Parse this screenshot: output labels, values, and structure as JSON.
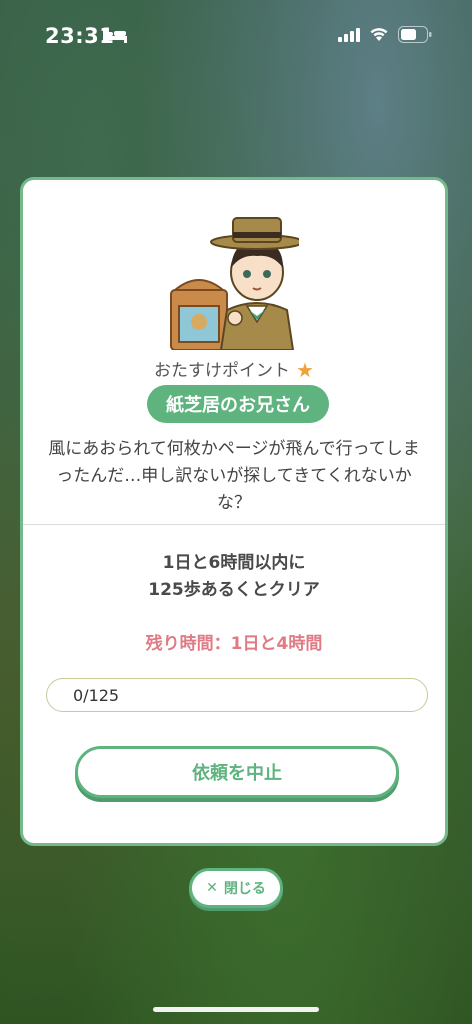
{
  "status_bar": {
    "time": "23:31",
    "sleep_icon": "bed-icon",
    "signal_icon": "cellular-signal-icon",
    "wifi_icon": "wifi-icon",
    "battery_icon": "battery-icon"
  },
  "card": {
    "illustration": "kamishibai-man-illustration",
    "points_label": "おたすけポイント",
    "points_icon": "star-icon",
    "name": "紙芝居のお兄さん",
    "message": "風にあおられて何枚かページが飛んで行ってしまったんだ…申し訳ないが探してきてくれないかな？",
    "goal_line1": "1日と6時間以内に",
    "goal_line2": "125歩あるくとクリア",
    "remaining": "残り時間：1日と4時間",
    "progress": {
      "text": "0/125",
      "current": 0,
      "total": 125
    },
    "cancel_label": "依頼を中止"
  },
  "close": {
    "icon": "close-icon",
    "label": "閉じる"
  },
  "colors": {
    "accent": "#5fb37f",
    "remaining": "#e07b86",
    "star": "#f0a23a"
  }
}
